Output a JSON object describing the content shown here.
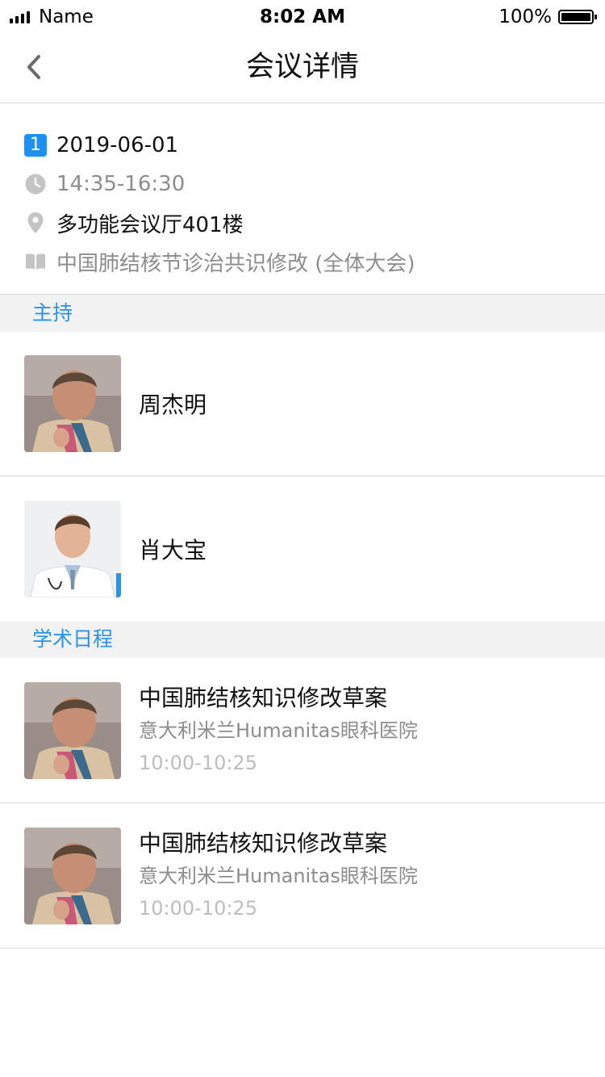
{
  "status_bar": {
    "carrier": "Name",
    "time": "8:02 AM",
    "battery": "100%"
  },
  "nav": {
    "title": "会议详情",
    "back_icon": "chevron-left-icon"
  },
  "meeting": {
    "day_badge": "1",
    "date": "2019-06-01",
    "time": "14:35-16:30",
    "location": "多功能会议厅401楼",
    "topic": "中国肺结核节诊治共识修改 (全体大会)"
  },
  "hosts_section": {
    "title": "主持",
    "items": [
      {
        "name": "周杰明"
      },
      {
        "name": "肖大宝"
      }
    ]
  },
  "schedule_section": {
    "title": "学术日程",
    "items": [
      {
        "title": "中国肺结核知识修改草案",
        "org": "意大利米兰Humanitas眼科医院",
        "time": "10:00-10:25"
      },
      {
        "title": "中国肺结核知识修改草案",
        "org": "意大利米兰Humanitas眼科医院",
        "time": "10:00-10:25"
      }
    ]
  },
  "colors": {
    "accent": "#2a93e8",
    "badge": "#1e90f0",
    "section_bg": "#f2f2f2",
    "secondary_text": "#8d8d8d",
    "tertiary_text": "#bdbdbd"
  }
}
